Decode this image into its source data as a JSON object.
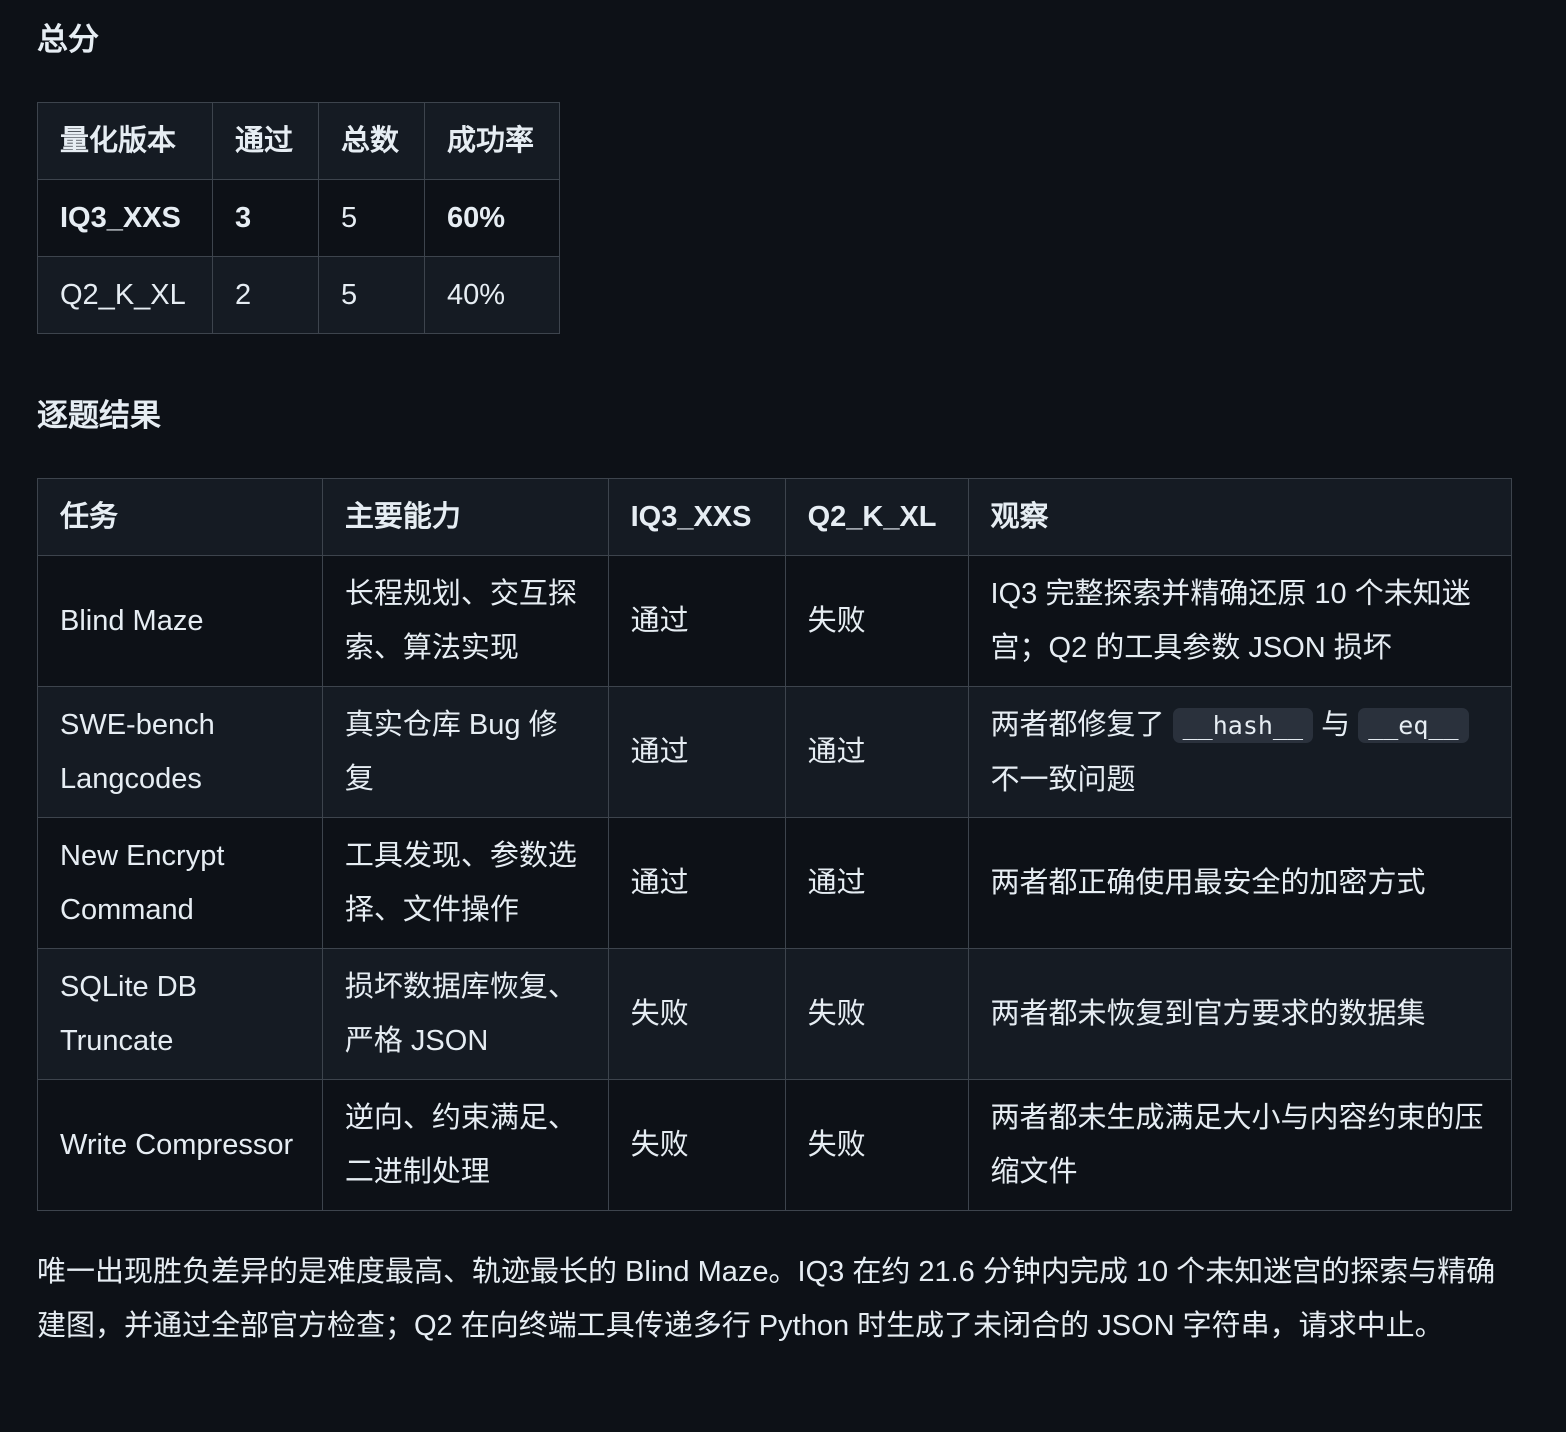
{
  "summary": {
    "heading": "总分",
    "headers": [
      "量化版本",
      "通过",
      "总数",
      "成功率"
    ],
    "rows": [
      {
        "version": "IQ3_XXS",
        "pass": "3",
        "total": "5",
        "rate": "60%"
      },
      {
        "version": "Q2_K_XL",
        "pass": "2",
        "total": "5",
        "rate": "40%"
      }
    ]
  },
  "details": {
    "heading": "逐题结果",
    "headers": [
      "任务",
      "主要能力",
      "IQ3_XXS",
      "Q2_K_XL",
      "观察"
    ],
    "rows": [
      {
        "task": "Blind Maze",
        "ability": "长程规划、交互探索、算法实现",
        "iq3": "通过",
        "q2": "失败",
        "obs": "IQ3 完整探索并精确还原 10 个未知迷宫；Q2 的工具参数 JSON 损坏"
      },
      {
        "task": "SWE-bench Langcodes",
        "ability": "真实仓库 Bug 修复",
        "iq3": "通过",
        "q2": "通过",
        "obs_pre": "两者都修复了",
        "obs_code1": "__hash__",
        "obs_mid": "与",
        "obs_code2": "__eq__",
        "obs_post": "不一致问题"
      },
      {
        "task": "New Encrypt Command",
        "ability": "工具发现、参数选择、文件操作",
        "iq3": "通过",
        "q2": "通过",
        "obs": "两者都正确使用最安全的加密方式"
      },
      {
        "task": "SQLite DB Truncate",
        "ability": "损坏数据库恢复、严格 JSON",
        "iq3": "失败",
        "q2": "失败",
        "obs": "两者都未恢复到官方要求的数据集"
      },
      {
        "task": "Write Compressor",
        "ability": "逆向、约束满足、二进制处理",
        "iq3": "失败",
        "q2": "失败",
        "obs": "两者都未生成满足大小与内容约束的压缩文件"
      }
    ]
  },
  "conclusion": "唯一出现胜负差异的是难度最高、轨迹最长的 Blind Maze。IQ3 在约 21.6 分钟内完成 10 个未知迷宫的探索与精确建图，并通过全部官方检查；Q2 在向终端工具传递多行 Python 时生成了未闭合的 JSON 字符串，请求中止。"
}
